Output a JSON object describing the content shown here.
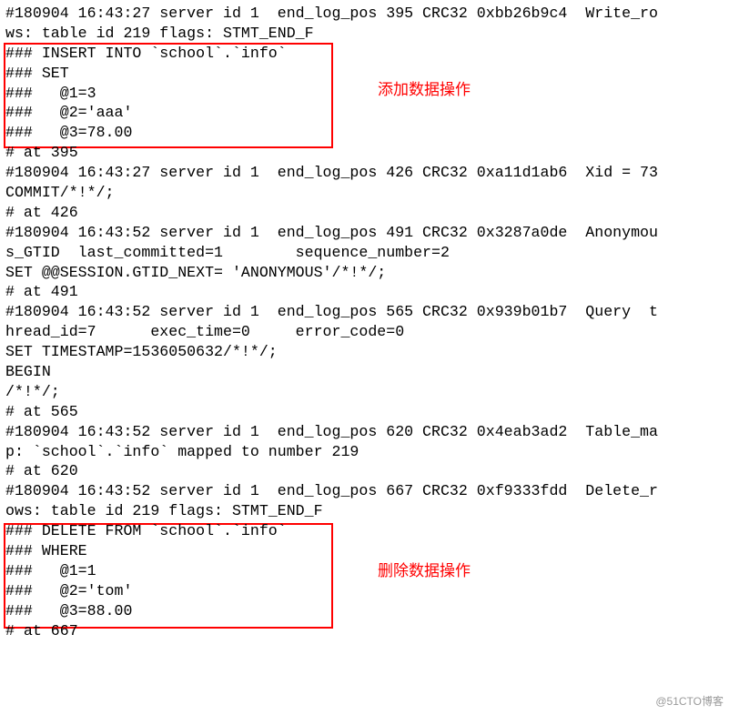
{
  "log": {
    "lines": [
      "#180904 16:43:27 server id 1  end_log_pos 395 CRC32 0xbb26b9c4  Write_ro",
      "ws: table id 219 flags: STMT_END_F",
      "### INSERT INTO `school`.`info`",
      "### SET",
      "###   @1=3",
      "###   @2='aaa'",
      "###   @3=78.00",
      "# at 395",
      "#180904 16:43:27 server id 1  end_log_pos 426 CRC32 0xa11d1ab6  Xid = 73",
      "COMMIT/*!*/;",
      "# at 426",
      "#180904 16:43:52 server id 1  end_log_pos 491 CRC32 0x3287a0de  Anonymou",
      "s_GTID  last_committed=1        sequence_number=2",
      "SET @@SESSION.GTID_NEXT= 'ANONYMOUS'/*!*/;",
      "# at 491",
      "#180904 16:43:52 server id 1  end_log_pos 565 CRC32 0x939b01b7  Query  t",
      "hread_id=7      exec_time=0     error_code=0",
      "SET TIMESTAMP=1536050632/*!*/;",
      "BEGIN",
      "/*!*/;",
      "# at 565",
      "#180904 16:43:52 server id 1  end_log_pos 620 CRC32 0x4eab3ad2  Table_ma",
      "p: `school`.`info` mapped to number 219",
      "# at 620",
      "#180904 16:43:52 server id 1  end_log_pos 667 CRC32 0xf9333fdd  Delete_r",
      "ows: table id 219 flags: STMT_END_F",
      "### DELETE FROM `school`.`info`",
      "### WHERE",
      "###   @1=1",
      "###   @2='tom'",
      "###   @3=88.00",
      "# at 667"
    ]
  },
  "annotations": {
    "insert": "添加数据操作",
    "delete": "删除数据操作"
  },
  "watermark": "@51CTO博客"
}
